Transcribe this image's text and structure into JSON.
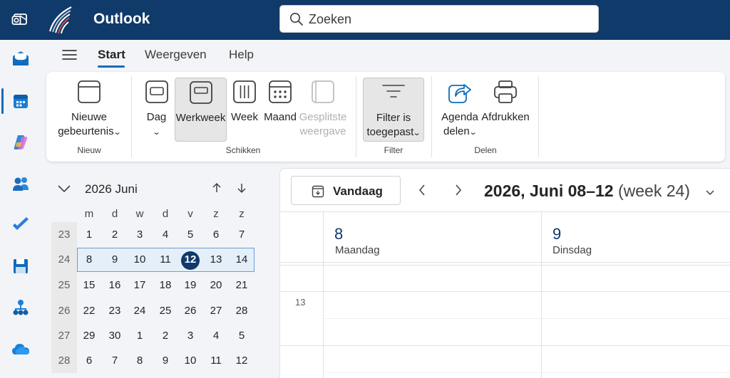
{
  "header": {
    "app_title": "Outlook",
    "search_placeholder": "Zoeken"
  },
  "rail": {
    "items": [
      "mail-icon",
      "calendar-icon",
      "copilot-icon",
      "people-icon",
      "todo-icon",
      "save-icon",
      "org-icon",
      "onedrive-icon"
    ],
    "active_item": "calendar-icon"
  },
  "tabs": {
    "menu_icon": "hamburger-icon",
    "items": [
      "Start",
      "Weergeven",
      "Help"
    ],
    "active": "Start"
  },
  "ribbon": {
    "new_event": {
      "line1": "Nieuwe",
      "line2": "gebeurtenis"
    },
    "group_new": "Nieuw",
    "day": "Dag",
    "workweek": "Werkweek",
    "week": "Week",
    "month": "Maand",
    "split_view": {
      "line1": "Gesplitste",
      "line2": "weergave"
    },
    "group_arrange": "Schikken",
    "filter": {
      "line1": "Filter is",
      "line2": "toegepast"
    },
    "group_filter": "Filter",
    "share_calendar": {
      "line1": "Agenda",
      "line2": "delen"
    },
    "print": "Afdrukken",
    "group_share": "Delen"
  },
  "mini_calendar": {
    "title": "2026 Juni",
    "weekdays": [
      "m",
      "d",
      "w",
      "d",
      "v",
      "z",
      "z"
    ],
    "weeks": [
      {
        "week": "23",
        "days": [
          "1",
          "2",
          "3",
          "4",
          "5",
          "6",
          "7"
        ]
      },
      {
        "week": "24",
        "days": [
          "8",
          "9",
          "10",
          "11",
          "12",
          "13",
          "14"
        ]
      },
      {
        "week": "25",
        "days": [
          "15",
          "16",
          "17",
          "18",
          "19",
          "20",
          "21"
        ]
      },
      {
        "week": "26",
        "days": [
          "22",
          "23",
          "24",
          "25",
          "26",
          "27",
          "28"
        ]
      },
      {
        "week": "27",
        "days": [
          "29",
          "30",
          "1",
          "2",
          "3",
          "4",
          "5"
        ]
      },
      {
        "week": "28",
        "days": [
          "6",
          "7",
          "8",
          "9",
          "10",
          "11",
          "12"
        ]
      }
    ],
    "selected_week": "24",
    "today": "12"
  },
  "calendar": {
    "today_button": "Vandaag",
    "range_title": "2026, Juni 08–12",
    "range_week": "(week 24)",
    "days": [
      {
        "num": "8",
        "name": "Maandag"
      },
      {
        "num": "9",
        "name": "Dinsdag"
      }
    ],
    "hour_label": "13"
  },
  "colors": {
    "topbar": "#0f3a6a",
    "accent": "#0f6cbd",
    "today_circle": "#0f3a6a",
    "selected_week_bg": "#e5eff9"
  }
}
